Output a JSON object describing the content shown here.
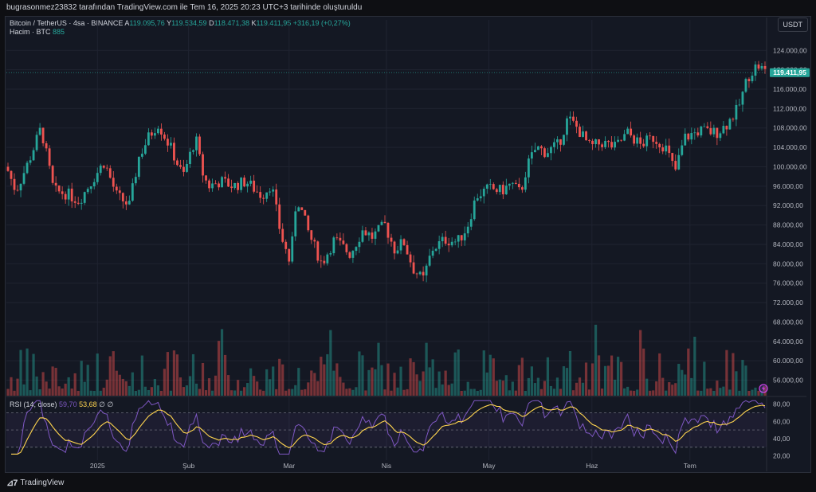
{
  "header": {
    "title": "bugrasonmez23832 tarafından TradingView.com ile Tem 16, 2025 20:23 UTC+3 tarihinde oluşturuldu"
  },
  "currency_button": "USDT",
  "legend": {
    "symbol": "Bitcoin / TetherUS · 4sa · BINANCE",
    "a_label": "A",
    "a_value": "119.095,76",
    "y_label": "Y",
    "y_value": "119.534,59",
    "d_label": "D",
    "d_value": "118.471,38",
    "k_label": "K",
    "k_value": "119.411,95",
    "change": "+316,19 (+0,27%)",
    "volume_label": "Hacim · BTC",
    "volume_value": "885"
  },
  "rsi_legend": {
    "label": "RSI (14, close)",
    "rsi_value": "59,70",
    "ma_value": "53,68",
    "extra1": "∅",
    "extra2": "∅"
  },
  "price_badge": "119.411,95",
  "footer": {
    "brand": "TradingView"
  },
  "colors": {
    "up": "#26a69a",
    "down": "#ef5350",
    "rsi": "#7e57c2",
    "rsi_ma": "#ffd54f",
    "badge": "#26a69a"
  },
  "chart_data": {
    "type": "candlestick",
    "price_axis_ticks": [
      "124.000,00",
      "120.000,00",
      "116.000,00",
      "112.000,00",
      "108.000,00",
      "104.000,00",
      "100.000,00",
      "96.000,00",
      "92.000,00",
      "88.000,00",
      "84.000,00",
      "80.000,00",
      "76.000,00",
      "72.000,00",
      "68.000,00",
      "64.000,00",
      "60.000,00",
      "56.000,00"
    ],
    "price_axis_values": [
      124000,
      120000,
      116000,
      112000,
      108000,
      104000,
      100000,
      96000,
      92000,
      88000,
      84000,
      80000,
      76000,
      72000,
      68000,
      64000,
      60000,
      56000
    ],
    "price_range": [
      52800,
      127000
    ],
    "rsi_axis_ticks": [
      "80,00",
      "60,00",
      "40,00",
      "20,00"
    ],
    "rsi_axis_values": [
      80,
      60,
      40,
      20
    ],
    "rsi_range": [
      15,
      87
    ],
    "rsi_band": [
      30,
      70
    ],
    "time_axis": [
      {
        "label": "2025",
        "t": 0.145
      },
      {
        "label": "Şub",
        "t": 0.29
      },
      {
        "label": "Mar",
        "t": 0.45
      },
      {
        "label": "Nis",
        "t": 0.605
      },
      {
        "label": "May",
        "t": 0.768
      },
      {
        "label": "Haz",
        "t": 0.932
      },
      {
        "label": "Tem",
        "t": 1.088
      }
    ],
    "price_path_anchors": [
      [
        0,
        100000
      ],
      [
        0.015,
        95000
      ],
      [
        0.035,
        101000
      ],
      [
        0.055,
        108000
      ],
      [
        0.075,
        95000
      ],
      [
        0.095,
        94500
      ],
      [
        0.115,
        93000
      ],
      [
        0.135,
        97000
      ],
      [
        0.155,
        101000
      ],
      [
        0.175,
        94000
      ],
      [
        0.195,
        92000
      ],
      [
        0.21,
        102000
      ],
      [
        0.225,
        106000
      ],
      [
        0.24,
        109000
      ],
      [
        0.26,
        104000
      ],
      [
        0.28,
        98000
      ],
      [
        0.3,
        106000
      ],
      [
        0.31,
        99000
      ],
      [
        0.32,
        96000
      ],
      [
        0.34,
        97000
      ],
      [
        0.36,
        96000
      ],
      [
        0.38,
        97000
      ],
      [
        0.405,
        94000
      ],
      [
        0.42,
        96500
      ],
      [
        0.435,
        86000
      ],
      [
        0.45,
        80000
      ],
      [
        0.46,
        94000
      ],
      [
        0.47,
        90000
      ],
      [
        0.48,
        86000
      ],
      [
        0.5,
        80000
      ],
      [
        0.52,
        85000
      ],
      [
        0.545,
        82000
      ],
      [
        0.565,
        87000
      ],
      [
        0.58,
        85500
      ],
      [
        0.6,
        88000
      ],
      [
        0.615,
        83000
      ],
      [
        0.63,
        84500
      ],
      [
        0.645,
        79000
      ],
      [
        0.66,
        76500
      ],
      [
        0.675,
        83000
      ],
      [
        0.695,
        85000
      ],
      [
        0.715,
        84500
      ],
      [
        0.73,
        87500
      ],
      [
        0.745,
        94000
      ],
      [
        0.765,
        95500
      ],
      [
        0.785,
        95000
      ],
      [
        0.8,
        96500
      ],
      [
        0.815,
        94500
      ],
      [
        0.825,
        100000
      ],
      [
        0.84,
        104000
      ],
      [
        0.855,
        103000
      ],
      [
        0.875,
        104500
      ],
      [
        0.89,
        110000
      ],
      [
        0.905,
        108000
      ],
      [
        0.925,
        104000
      ],
      [
        0.945,
        105000
      ],
      [
        0.965,
        104000
      ],
      [
        0.985,
        107000
      ],
      [
        1.005,
        104500
      ],
      [
        1.025,
        106000
      ],
      [
        1.045,
        104000
      ],
      [
        1.06,
        99000
      ],
      [
        1.075,
        106000
      ],
      [
        1.1,
        107500
      ],
      [
        1.125,
        107000
      ],
      [
        1.14,
        108500
      ],
      [
        1.16,
        112000
      ],
      [
        1.175,
        118500
      ],
      [
        1.19,
        121000
      ],
      [
        1.205,
        119411
      ]
    ]
  }
}
